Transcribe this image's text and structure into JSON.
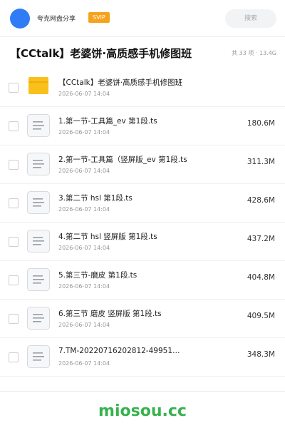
{
  "header": {
    "share_name": "夸克网盘分享",
    "vip_badge": "SVIP",
    "search_placeholder": "搜索"
  },
  "folder": {
    "title": "【CCtalk】老婆饼·高质感手机修图班",
    "summary": "共 33 项 · 13.4G"
  },
  "items": [
    {
      "type": "folder",
      "name": "【CCtalk】老婆饼·高质感手机修图班",
      "date": "2026-06-07 14:04",
      "size": ""
    },
    {
      "type": "file",
      "name": "1.第一节-工具篇_ev 第1段.ts",
      "date": "2026-06-07 14:04",
      "size": "180.6M"
    },
    {
      "type": "file",
      "name": "2.第一节-工具篇（竖屏版_ev 第1段.ts",
      "date": "2026-06-07 14:04",
      "size": "311.3M"
    },
    {
      "type": "file",
      "name": "3.第二节 hsl 第1段.ts",
      "date": "2026-06-07 14:04",
      "size": "428.6M"
    },
    {
      "type": "file",
      "name": "4.第二节 hsl 竖屏版 第1段.ts",
      "date": "2026-06-07 14:04",
      "size": "437.2M"
    },
    {
      "type": "file",
      "name": "5.第三节-磨皮 第1段.ts",
      "date": "2026-06-07 14:04",
      "size": "404.8M"
    },
    {
      "type": "file",
      "name": "6.第三节 磨皮 竖屏版 第1段.ts",
      "date": "2026-06-07 14:04",
      "size": "409.5M"
    },
    {
      "type": "file",
      "name": "7.TM-20220716202812-49951…",
      "date": "2026-06-07 14:04",
      "size": "348.3M"
    }
  ],
  "watermark": "miosou.cc",
  "colors": {
    "avatar": "#2f7cf6",
    "vip": "#f7a21b",
    "folder": "#f9bf1a",
    "watermark": "#37b24d"
  }
}
